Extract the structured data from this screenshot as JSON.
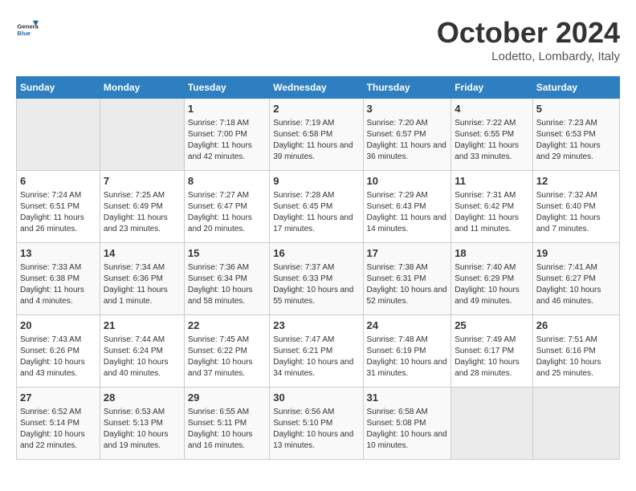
{
  "header": {
    "logo_general": "General",
    "logo_blue": "Blue",
    "month_title": "October 2024",
    "location": "Lodetto, Lombardy, Italy"
  },
  "days_of_week": [
    "Sunday",
    "Monday",
    "Tuesday",
    "Wednesday",
    "Thursday",
    "Friday",
    "Saturday"
  ],
  "weeks": [
    [
      {
        "day": "",
        "sunrise": "",
        "sunset": "",
        "daylight": ""
      },
      {
        "day": "",
        "sunrise": "",
        "sunset": "",
        "daylight": ""
      },
      {
        "day": "1",
        "sunrise": "Sunrise: 7:18 AM",
        "sunset": "Sunset: 7:00 PM",
        "daylight": "Daylight: 11 hours and 42 minutes."
      },
      {
        "day": "2",
        "sunrise": "Sunrise: 7:19 AM",
        "sunset": "Sunset: 6:58 PM",
        "daylight": "Daylight: 11 hours and 39 minutes."
      },
      {
        "day": "3",
        "sunrise": "Sunrise: 7:20 AM",
        "sunset": "Sunset: 6:57 PM",
        "daylight": "Daylight: 11 hours and 36 minutes."
      },
      {
        "day": "4",
        "sunrise": "Sunrise: 7:22 AM",
        "sunset": "Sunset: 6:55 PM",
        "daylight": "Daylight: 11 hours and 33 minutes."
      },
      {
        "day": "5",
        "sunrise": "Sunrise: 7:23 AM",
        "sunset": "Sunset: 6:53 PM",
        "daylight": "Daylight: 11 hours and 29 minutes."
      }
    ],
    [
      {
        "day": "6",
        "sunrise": "Sunrise: 7:24 AM",
        "sunset": "Sunset: 6:51 PM",
        "daylight": "Daylight: 11 hours and 26 minutes."
      },
      {
        "day": "7",
        "sunrise": "Sunrise: 7:25 AM",
        "sunset": "Sunset: 6:49 PM",
        "daylight": "Daylight: 11 hours and 23 minutes."
      },
      {
        "day": "8",
        "sunrise": "Sunrise: 7:27 AM",
        "sunset": "Sunset: 6:47 PM",
        "daylight": "Daylight: 11 hours and 20 minutes."
      },
      {
        "day": "9",
        "sunrise": "Sunrise: 7:28 AM",
        "sunset": "Sunset: 6:45 PM",
        "daylight": "Daylight: 11 hours and 17 minutes."
      },
      {
        "day": "10",
        "sunrise": "Sunrise: 7:29 AM",
        "sunset": "Sunset: 6:43 PM",
        "daylight": "Daylight: 11 hours and 14 minutes."
      },
      {
        "day": "11",
        "sunrise": "Sunrise: 7:31 AM",
        "sunset": "Sunset: 6:42 PM",
        "daylight": "Daylight: 11 hours and 11 minutes."
      },
      {
        "day": "12",
        "sunrise": "Sunrise: 7:32 AM",
        "sunset": "Sunset: 6:40 PM",
        "daylight": "Daylight: 11 hours and 7 minutes."
      }
    ],
    [
      {
        "day": "13",
        "sunrise": "Sunrise: 7:33 AM",
        "sunset": "Sunset: 6:38 PM",
        "daylight": "Daylight: 11 hours and 4 minutes."
      },
      {
        "day": "14",
        "sunrise": "Sunrise: 7:34 AM",
        "sunset": "Sunset: 6:36 PM",
        "daylight": "Daylight: 11 hours and 1 minute."
      },
      {
        "day": "15",
        "sunrise": "Sunrise: 7:36 AM",
        "sunset": "Sunset: 6:34 PM",
        "daylight": "Daylight: 10 hours and 58 minutes."
      },
      {
        "day": "16",
        "sunrise": "Sunrise: 7:37 AM",
        "sunset": "Sunset: 6:33 PM",
        "daylight": "Daylight: 10 hours and 55 minutes."
      },
      {
        "day": "17",
        "sunrise": "Sunrise: 7:38 AM",
        "sunset": "Sunset: 6:31 PM",
        "daylight": "Daylight: 10 hours and 52 minutes."
      },
      {
        "day": "18",
        "sunrise": "Sunrise: 7:40 AM",
        "sunset": "Sunset: 6:29 PM",
        "daylight": "Daylight: 10 hours and 49 minutes."
      },
      {
        "day": "19",
        "sunrise": "Sunrise: 7:41 AM",
        "sunset": "Sunset: 6:27 PM",
        "daylight": "Daylight: 10 hours and 46 minutes."
      }
    ],
    [
      {
        "day": "20",
        "sunrise": "Sunrise: 7:43 AM",
        "sunset": "Sunset: 6:26 PM",
        "daylight": "Daylight: 10 hours and 43 minutes."
      },
      {
        "day": "21",
        "sunrise": "Sunrise: 7:44 AM",
        "sunset": "Sunset: 6:24 PM",
        "daylight": "Daylight: 10 hours and 40 minutes."
      },
      {
        "day": "22",
        "sunrise": "Sunrise: 7:45 AM",
        "sunset": "Sunset: 6:22 PM",
        "daylight": "Daylight: 10 hours and 37 minutes."
      },
      {
        "day": "23",
        "sunrise": "Sunrise: 7:47 AM",
        "sunset": "Sunset: 6:21 PM",
        "daylight": "Daylight: 10 hours and 34 minutes."
      },
      {
        "day": "24",
        "sunrise": "Sunrise: 7:48 AM",
        "sunset": "Sunset: 6:19 PM",
        "daylight": "Daylight: 10 hours and 31 minutes."
      },
      {
        "day": "25",
        "sunrise": "Sunrise: 7:49 AM",
        "sunset": "Sunset: 6:17 PM",
        "daylight": "Daylight: 10 hours and 28 minutes."
      },
      {
        "day": "26",
        "sunrise": "Sunrise: 7:51 AM",
        "sunset": "Sunset: 6:16 PM",
        "daylight": "Daylight: 10 hours and 25 minutes."
      }
    ],
    [
      {
        "day": "27",
        "sunrise": "Sunrise: 6:52 AM",
        "sunset": "Sunset: 5:14 PM",
        "daylight": "Daylight: 10 hours and 22 minutes."
      },
      {
        "day": "28",
        "sunrise": "Sunrise: 6:53 AM",
        "sunset": "Sunset: 5:13 PM",
        "daylight": "Daylight: 10 hours and 19 minutes."
      },
      {
        "day": "29",
        "sunrise": "Sunrise: 6:55 AM",
        "sunset": "Sunset: 5:11 PM",
        "daylight": "Daylight: 10 hours and 16 minutes."
      },
      {
        "day": "30",
        "sunrise": "Sunrise: 6:56 AM",
        "sunset": "Sunset: 5:10 PM",
        "daylight": "Daylight: 10 hours and 13 minutes."
      },
      {
        "day": "31",
        "sunrise": "Sunrise: 6:58 AM",
        "sunset": "Sunset: 5:08 PM",
        "daylight": "Daylight: 10 hours and 10 minutes."
      },
      {
        "day": "",
        "sunrise": "",
        "sunset": "",
        "daylight": ""
      },
      {
        "day": "",
        "sunrise": "",
        "sunset": "",
        "daylight": ""
      }
    ]
  ]
}
